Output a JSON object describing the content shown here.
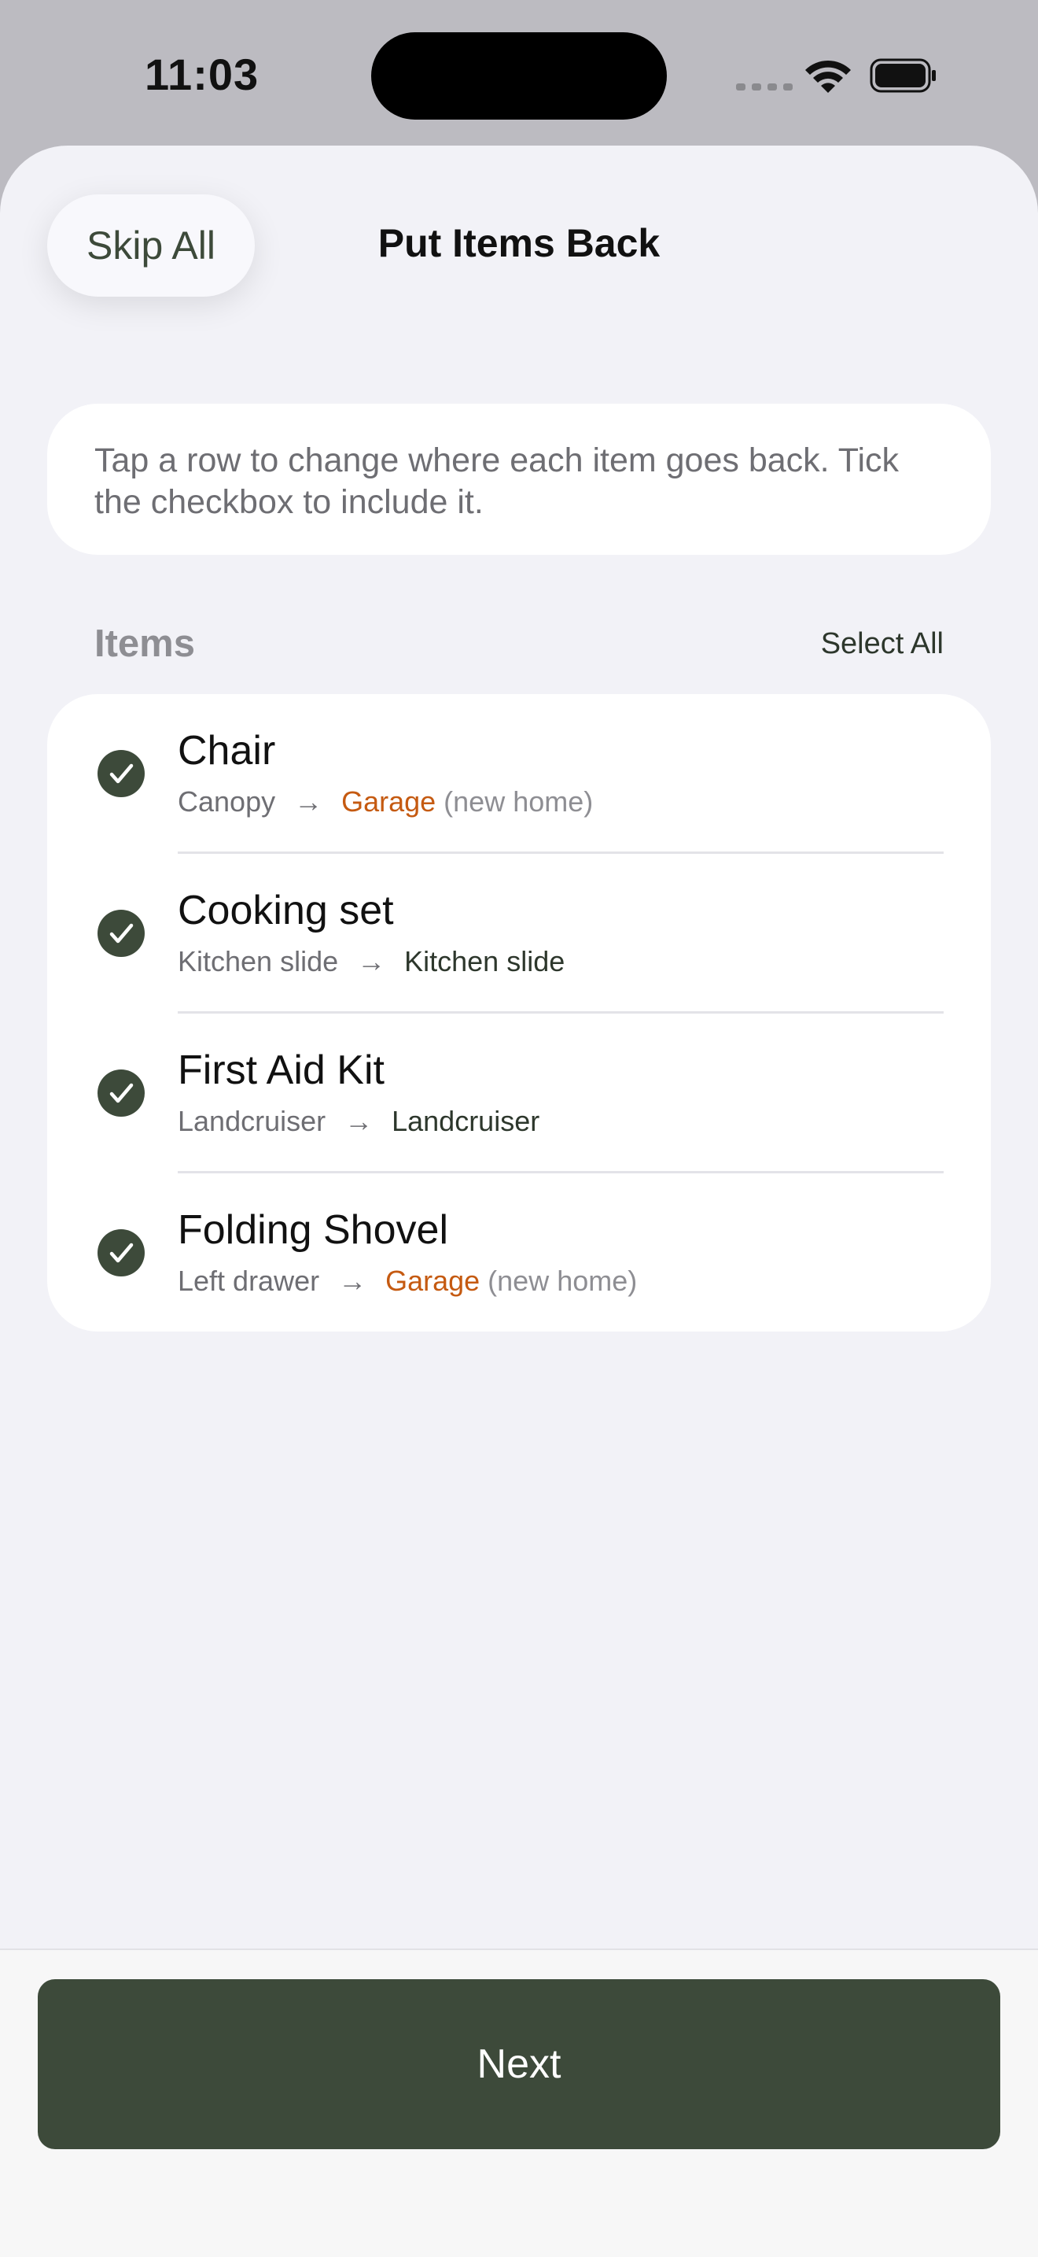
{
  "status_bar": {
    "time": "11:03"
  },
  "header": {
    "skip_label": "Skip All",
    "title": "Put Items Back"
  },
  "info": {
    "text": "Tap a row to change where each item goes back. Tick the checkbox to include it."
  },
  "items_section": {
    "title": "Items",
    "select_all_label": "Select All"
  },
  "items": [
    {
      "name": "Chair",
      "from": "Canopy",
      "arrow": "→",
      "to": "Garage",
      "note": "(new home)",
      "checked": true
    },
    {
      "name": "Cooking set",
      "from": "Kitchen slide",
      "arrow": "→",
      "to": "Kitchen slide",
      "note": "",
      "checked": true
    },
    {
      "name": "First Aid Kit",
      "from": "Landcruiser",
      "arrow": "→",
      "to": "Landcruiser",
      "note": "",
      "checked": true
    },
    {
      "name": "Folding Shovel",
      "from": "Left drawer",
      "arrow": "→",
      "to": "Garage",
      "note": "(new home)",
      "checked": true
    }
  ],
  "footer": {
    "next_label": "Next"
  },
  "colors": {
    "accent": "#3d4a3a",
    "new_home": "#c55a11",
    "background": "#f2f2f7"
  }
}
